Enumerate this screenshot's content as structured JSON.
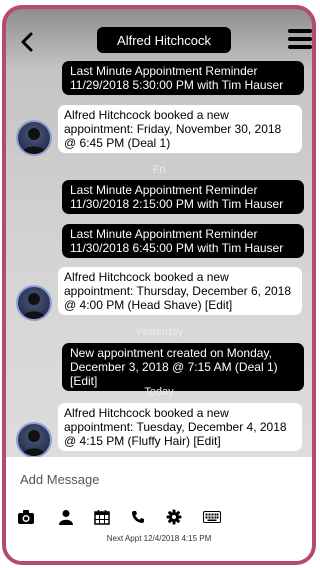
{
  "header": {
    "title": "Alfred Hitchcock",
    "back_icon": "chevron-left-icon",
    "menu_icon": "hamburger-menu-icon"
  },
  "messages": [
    {
      "type": "sent",
      "text": "Last Minute Appointment Reminder 11/29/2018 5:30:00 PM with Tim Hauser"
    },
    {
      "type": "received",
      "text": "Alfred Hitchcock booked a new appointment: Friday, November 30, 2018 @ 6:45 PM (Deal 1)"
    },
    {
      "type": "separator",
      "text": "Fri"
    },
    {
      "type": "sent",
      "text": "Last Minute Appointment Reminder 11/30/2018 2:15:00 PM with Tim Hauser"
    },
    {
      "type": "sent",
      "text": "Last Minute Appointment Reminder 11/30/2018 6:45:00 PM with Tim Hauser"
    },
    {
      "type": "received",
      "text": "Alfred Hitchcock booked a new appointment: Thursday, December 6, 2018 @ 4:00 PM (Head Shave) [Edit]"
    },
    {
      "type": "separator",
      "text": "Yesterday"
    },
    {
      "type": "sent",
      "text": "New appointment created on Monday, December 3, 2018 @ 7:15 AM (Deal 1) [Edit]"
    },
    {
      "type": "separator",
      "text": "Today"
    },
    {
      "type": "received",
      "text": "Alfred Hitchcock booked a new appointment: Tuesday, December 4, 2018 @ 4:15 PM (Fluffy Hair) [Edit]"
    }
  ],
  "composer": {
    "placeholder": "Add Message",
    "value": "",
    "toolbar_icons": [
      "camera-icon",
      "person-icon",
      "calendar-icon",
      "phone-icon",
      "gear-icon",
      "keyboard-icon"
    ],
    "next_appt": "Next Appt 12/4/2018 4:15 PM"
  },
  "colors": {
    "border": "#b24a73",
    "sent_bubble": "#000000",
    "received_bubble": "#ffffff"
  }
}
